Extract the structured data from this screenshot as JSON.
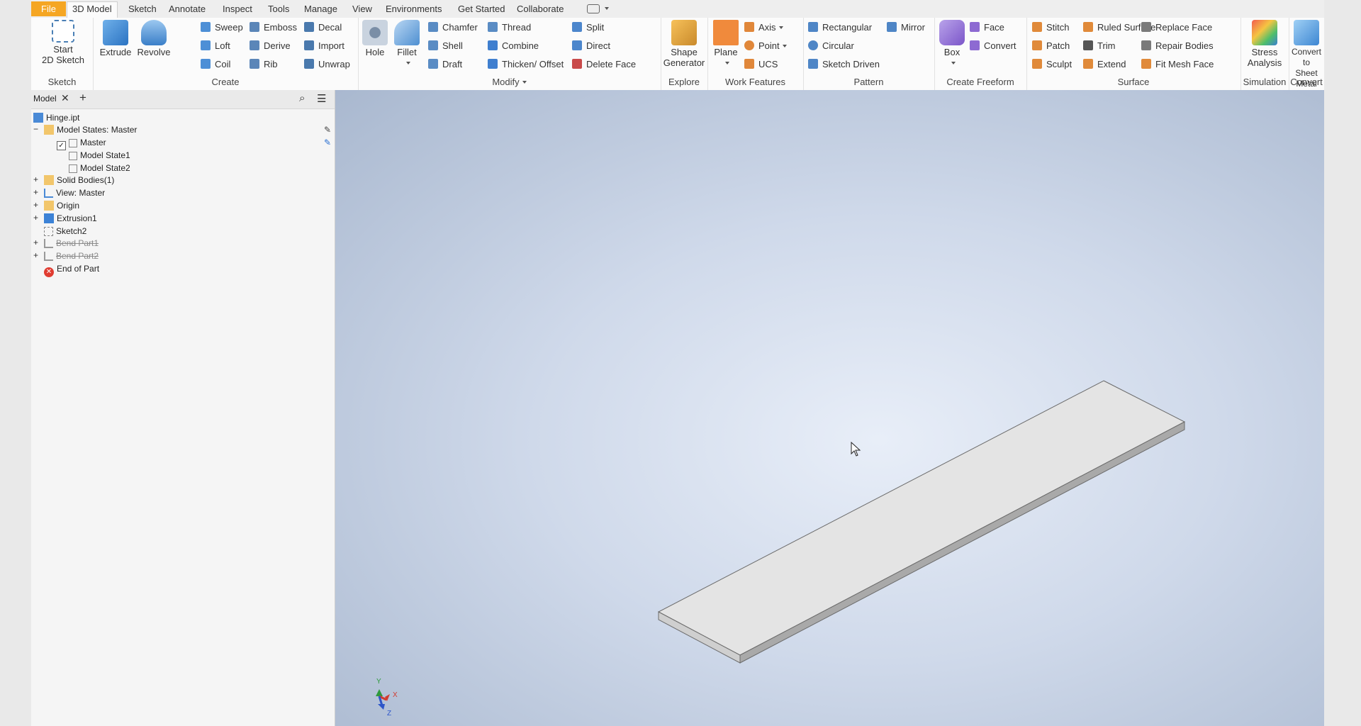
{
  "tabs": [
    "File",
    "3D Model",
    "Sketch",
    "Annotate",
    "Inspect",
    "Tools",
    "Manage",
    "View",
    "Environments",
    "Get Started",
    "Collaborate"
  ],
  "ribbon": {
    "sketch": {
      "title": "Sketch",
      "start": "Start\n2D Sketch"
    },
    "create": {
      "title": "Create",
      "extrude": "Extrude",
      "revolve": "Revolve",
      "sweep": "Sweep",
      "loft": "Loft",
      "coil": "Coil",
      "emboss": "Emboss",
      "derive": "Derive",
      "rib": "Rib",
      "decal": "Decal",
      "import": "Import",
      "unwrap": "Unwrap"
    },
    "modify": {
      "title": "Modify",
      "hole": "Hole",
      "fillet": "Fillet",
      "chamfer": "Chamfer",
      "shell": "Shell",
      "draft": "Draft",
      "thread": "Thread",
      "combine": "Combine",
      "thicken": "Thicken/ Offset",
      "split": "Split",
      "direct": "Direct",
      "delete_face": "Delete Face"
    },
    "explore": {
      "title": "Explore",
      "shape": "Shape\nGenerator"
    },
    "work": {
      "title": "Work Features",
      "plane": "Plane",
      "axis": "Axis",
      "point": "Point",
      "ucs": "UCS"
    },
    "pattern": {
      "title": "Pattern",
      "rect": "Rectangular",
      "circ": "Circular",
      "sketch": "Sketch Driven",
      "mirror": "Mirror"
    },
    "freeform": {
      "title": "Create Freeform",
      "box": "Box",
      "face": "Face",
      "convert": "Convert"
    },
    "surface": {
      "title": "Surface",
      "stitch": "Stitch",
      "patch": "Patch",
      "sculpt": "Sculpt",
      "ruled": "Ruled Surface",
      "trim": "Trim",
      "extend": "Extend",
      "replace": "Replace Face",
      "repair": "Repair Bodies",
      "fit": "Fit Mesh Face"
    },
    "simulation": {
      "title": "Simulation",
      "stress": "Stress\nAnalysis"
    },
    "convert": {
      "title": "Convert",
      "sheet": "Convert to\nSheet Metal"
    }
  },
  "browser": {
    "tab_label": "Model",
    "items": [
      {
        "label": "Hinge.ipt"
      },
      {
        "label": "Model States: Master"
      },
      {
        "label": "Master"
      },
      {
        "label": "Model State1"
      },
      {
        "label": "Model State2"
      },
      {
        "label": "Solid Bodies(1)"
      },
      {
        "label": "View: Master"
      },
      {
        "label": "Origin"
      },
      {
        "label": "Extrusion1"
      },
      {
        "label": "Sketch2"
      },
      {
        "label": "Bend Part1"
      },
      {
        "label": "Bend Part2"
      },
      {
        "label": "End of Part"
      }
    ]
  },
  "viewcube": {
    "x": "X",
    "y": "Y",
    "z": "Z"
  },
  "colors": {
    "file_tab": "#f5a623",
    "viewport_top": "#a9b8cf",
    "part_face": "#e4e4e4"
  }
}
